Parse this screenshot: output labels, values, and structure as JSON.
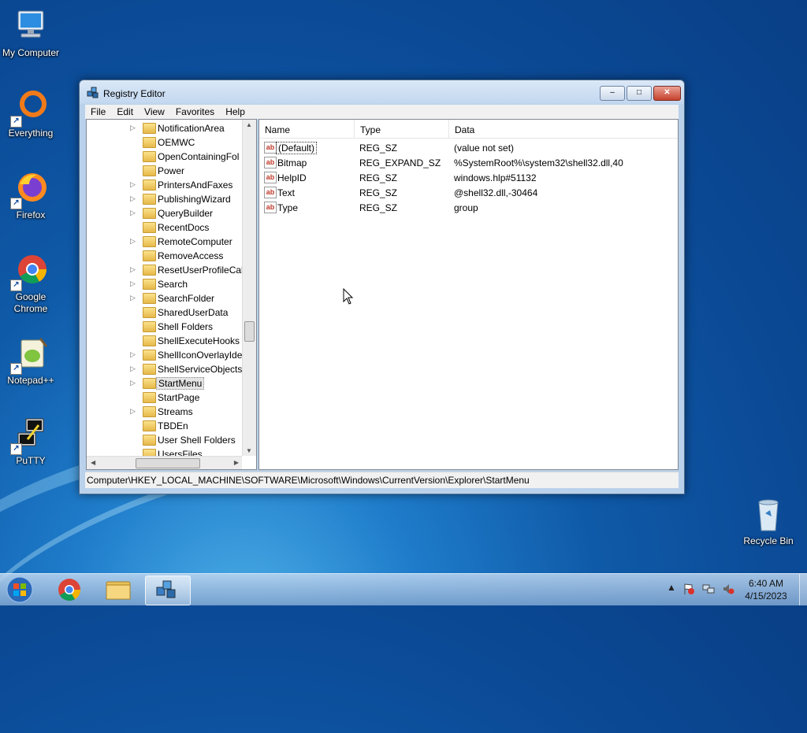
{
  "desktop": {
    "icons": [
      {
        "label": "My Computer"
      },
      {
        "label": "Everything"
      },
      {
        "label": "Firefox"
      },
      {
        "label": "Google Chrome"
      },
      {
        "label": "Notepad++"
      },
      {
        "label": "PuTTY"
      },
      {
        "label": "Recycle Bin"
      }
    ]
  },
  "window": {
    "title": "Registry Editor",
    "buttons": {
      "minimize": "–",
      "maximize": "□",
      "close": "✕"
    }
  },
  "menu": [
    "File",
    "Edit",
    "View",
    "Favorites",
    "Help"
  ],
  "tree": {
    "items": [
      {
        "label": "NotificationArea",
        "expandable": true
      },
      {
        "label": "OEMWC",
        "expandable": false
      },
      {
        "label": "OpenContainingFol",
        "expandable": false
      },
      {
        "label": "Power",
        "expandable": false
      },
      {
        "label": "PrintersAndFaxes",
        "expandable": true
      },
      {
        "label": "PublishingWizard",
        "expandable": true
      },
      {
        "label": "QueryBuilder",
        "expandable": true
      },
      {
        "label": "RecentDocs",
        "expandable": false
      },
      {
        "label": "RemoteComputer",
        "expandable": true
      },
      {
        "label": "RemoveAccess",
        "expandable": false
      },
      {
        "label": "ResetUserProfileCall",
        "expandable": true
      },
      {
        "label": "Search",
        "expandable": true
      },
      {
        "label": "SearchFolder",
        "expandable": true
      },
      {
        "label": "SharedUserData",
        "expandable": false
      },
      {
        "label": "Shell Folders",
        "expandable": false
      },
      {
        "label": "ShellExecuteHooks",
        "expandable": false
      },
      {
        "label": "ShellIconOverlayIde",
        "expandable": true
      },
      {
        "label": "ShellServiceObjects",
        "expandable": true
      },
      {
        "label": "StartMenu",
        "expandable": true,
        "selected": true
      },
      {
        "label": "StartPage",
        "expandable": false
      },
      {
        "label": "Streams",
        "expandable": true
      },
      {
        "label": "TBDEn",
        "expandable": false
      },
      {
        "label": "User Shell Folders",
        "expandable": false
      },
      {
        "label": "UsersFiles",
        "expandable": false
      }
    ]
  },
  "values": {
    "columns": {
      "name": "Name",
      "type": "Type",
      "data": "Data"
    },
    "rows": [
      {
        "name": "(Default)",
        "type": "REG_SZ",
        "data": "(value not set)",
        "icon": "ab"
      },
      {
        "name": "Bitmap",
        "type": "REG_EXPAND_SZ",
        "data": "%SystemRoot%\\system32\\shell32.dll,40",
        "icon": "ab"
      },
      {
        "name": "HelpID",
        "type": "REG_SZ",
        "data": "windows.hlp#51132",
        "icon": "ab"
      },
      {
        "name": "Text",
        "type": "REG_SZ",
        "data": "@shell32.dll,-30464",
        "icon": "ab"
      },
      {
        "name": "Type",
        "type": "REG_SZ",
        "data": "group",
        "icon": "ab"
      }
    ]
  },
  "status": {
    "path": "Computer\\HKEY_LOCAL_MACHINE\\SOFTWARE\\Microsoft\\Windows\\CurrentVersion\\Explorer\\StartMenu"
  },
  "taskbar": {
    "tray_arrow": "▲",
    "clock_time": "6:40 AM",
    "clock_date": "4/15/2023"
  }
}
